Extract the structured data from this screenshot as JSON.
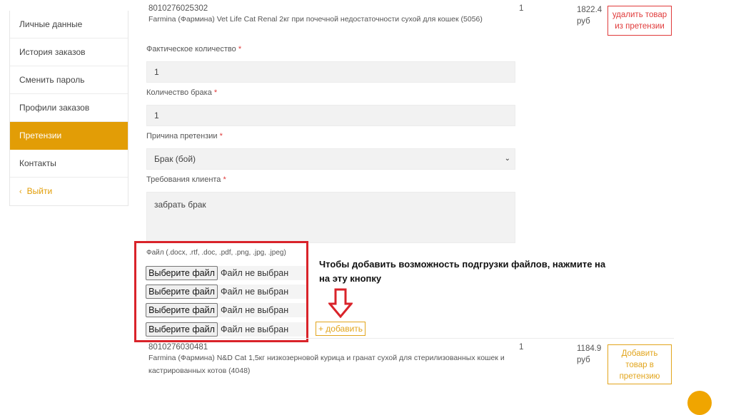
{
  "sidebar": {
    "items": [
      {
        "label": "Личные данные"
      },
      {
        "label": "История заказов"
      },
      {
        "label": "Сменить пароль"
      },
      {
        "label": "Профили заказов"
      },
      {
        "label": "Претензии"
      },
      {
        "label": "Контакты"
      },
      {
        "label": "Выйти"
      }
    ],
    "active_index": 4
  },
  "item1": {
    "sku": "8010276025302",
    "name": "Farmina (Фармина) Vet Life Cat Renal 2кг при почечной недостаточности сухой для кошек (5056)",
    "qty": "1",
    "price": "1822.4",
    "currency": "руб",
    "remove_label_line1": "удалить товар",
    "remove_label_line2": "из претензии"
  },
  "form": {
    "actual_qty_label": "Фактическое количество",
    "actual_qty_value": "1",
    "defect_qty_label": "Количество брака",
    "defect_qty_value": "1",
    "reason_label": "Причина претензии",
    "reason_value": "Брак (бой)",
    "requirement_label": "Требования клиента",
    "requirement_value": "забрать брак",
    "required_mark": "*",
    "file_label": "Файл (.docx, .rtf, .doc, .pdf, .png, .jpg, .jpeg)",
    "file_button": "Выберите файл",
    "file_status": "Файл не выбран",
    "add_label": "+ добавить"
  },
  "annotation": {
    "line1": "Чтобы добавить возможность подгрузки файлов, нажмите на",
    "line2": "на эту кнопку",
    "box_color": "#d9232a"
  },
  "item2": {
    "sku": "8010276030481",
    "name_line1": "Farmina (Фармина) N&D Cat 1,5кг низкозерновой курица и гранат сухой для стерилизованных кошек и",
    "name_line2": "кастрированных котов (4048)",
    "qty": "1",
    "price": "1184.9",
    "currency": "руб",
    "add_line1": "Добавить",
    "add_line2": "товар в",
    "add_line3": "претензию"
  },
  "colors": {
    "accent": "#e29d06",
    "danger": "#e03a3a",
    "add_border": "#e2a51d"
  }
}
